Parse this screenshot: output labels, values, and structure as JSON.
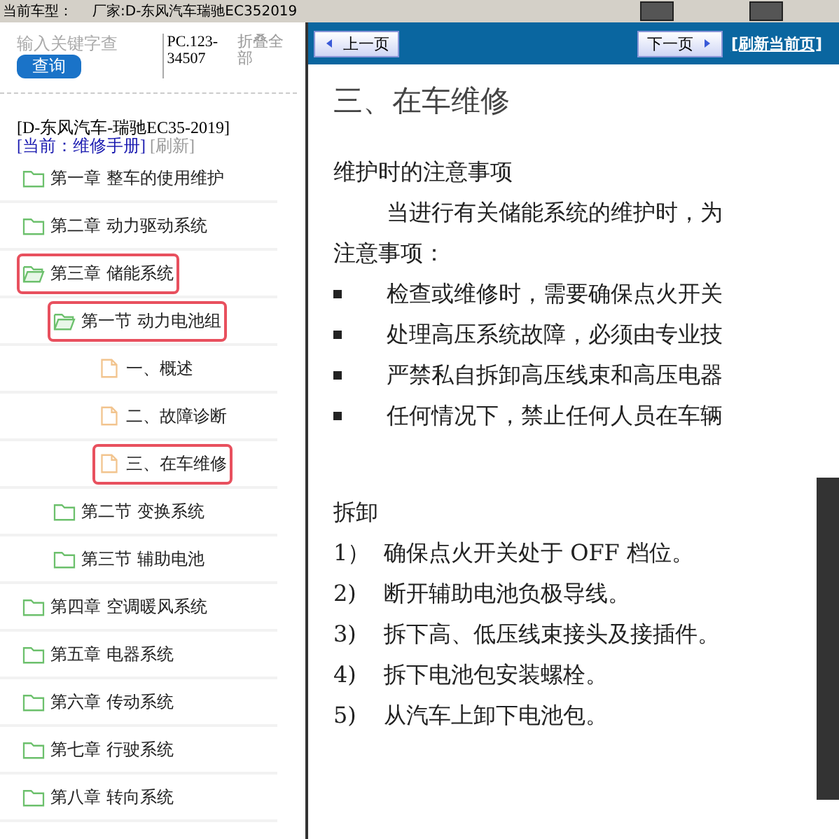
{
  "top_bar": {
    "model_label": "当前车型：",
    "maker": "厂家:D-东风汽车瑞驰EC352019"
  },
  "sidebar": {
    "search": {
      "placeholder": "输入关键字查"
    },
    "search_button": "查询",
    "code": "PC.123-34507",
    "collapse_all": "折叠全部",
    "model": "[D-东风汽车-瑞驰EC35-2019]",
    "current": "[当前：维修手册]",
    "refresh": "[刷新]",
    "tree": [
      {
        "label": "第一章 整车的使用维护",
        "kind": "folder",
        "expanded": false,
        "highlighted": false
      },
      {
        "label": "第二章 动力驱动系统",
        "kind": "folder",
        "expanded": false,
        "highlighted": false
      },
      {
        "label": "第三章 储能系统",
        "kind": "folder",
        "expanded": true,
        "highlighted": true,
        "children": [
          {
            "label": "第一节 动力电池组",
            "kind": "folder",
            "expanded": true,
            "highlighted": true,
            "children": [
              {
                "label": "一、概述",
                "kind": "page",
                "highlighted": false
              },
              {
                "label": "二、故障诊断",
                "kind": "page",
                "highlighted": false
              },
              {
                "label": "三、在车维修",
                "kind": "page",
                "highlighted": true
              }
            ]
          },
          {
            "label": "第二节 变换系统",
            "kind": "folder",
            "expanded": false,
            "highlighted": false
          },
          {
            "label": "第三节 辅助电池",
            "kind": "folder",
            "expanded": false,
            "highlighted": false
          }
        ]
      },
      {
        "label": "第四章 空调暖风系统",
        "kind": "folder",
        "expanded": false,
        "highlighted": false
      },
      {
        "label": "第五章 电器系统",
        "kind": "folder",
        "expanded": false,
        "highlighted": false
      },
      {
        "label": "第六章 传动系统",
        "kind": "folder",
        "expanded": false,
        "highlighted": false
      },
      {
        "label": "第七章 行驶系统",
        "kind": "folder",
        "expanded": false,
        "highlighted": false
      },
      {
        "label": "第八章 转向系统",
        "kind": "folder",
        "expanded": false,
        "highlighted": false
      }
    ]
  },
  "nav": {
    "prev": "上一页",
    "next": "下一页",
    "refresh": "[刷新当前页]"
  },
  "document": {
    "title": "三、在车维修",
    "heading": "维护时的注意事项",
    "intro": "当进行有关储能系统的维护时，为",
    "intro_end": "注意事项：",
    "bullets": [
      "检查或维修时，需要确保点火开关",
      "处理高压系统故障，必须由专业技",
      "严禁私自拆卸高压线束和高压电器",
      "任何情况下，禁止任何人员在车辆"
    ],
    "section": "拆卸",
    "steps": [
      {
        "number": "1）",
        "text": "确保点火开关处于 OFF 档位。"
      },
      {
        "number": "2)",
        "text": "断开辅助电池负极导线。"
      },
      {
        "number": "3)",
        "text": "拆下高、低压线束接头及接插件。"
      },
      {
        "number": "4)",
        "text": "拆下电池包安装螺栓。"
      },
      {
        "number": "5)",
        "text": "从汽车上卸下电池包。"
      }
    ]
  }
}
